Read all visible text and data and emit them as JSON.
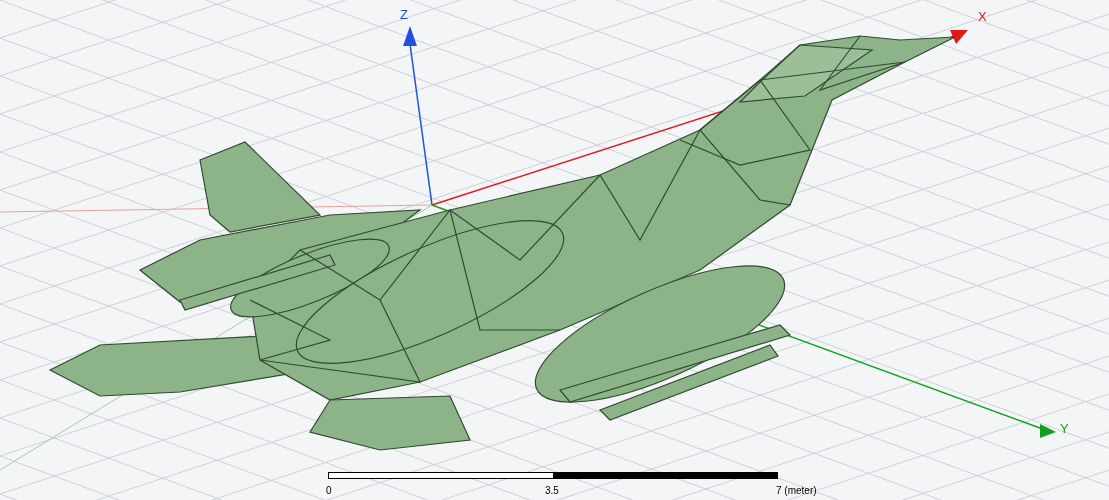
{
  "axes": [
    {
      "label": "Z",
      "color": "#2050e0"
    },
    {
      "label": "X",
      "color": "#e01818"
    },
    {
      "label": "Y",
      "color": "#10a020"
    }
  ],
  "scale_bar": {
    "ticks": [
      "0",
      "3.5",
      "7 (meter)"
    ]
  }
}
